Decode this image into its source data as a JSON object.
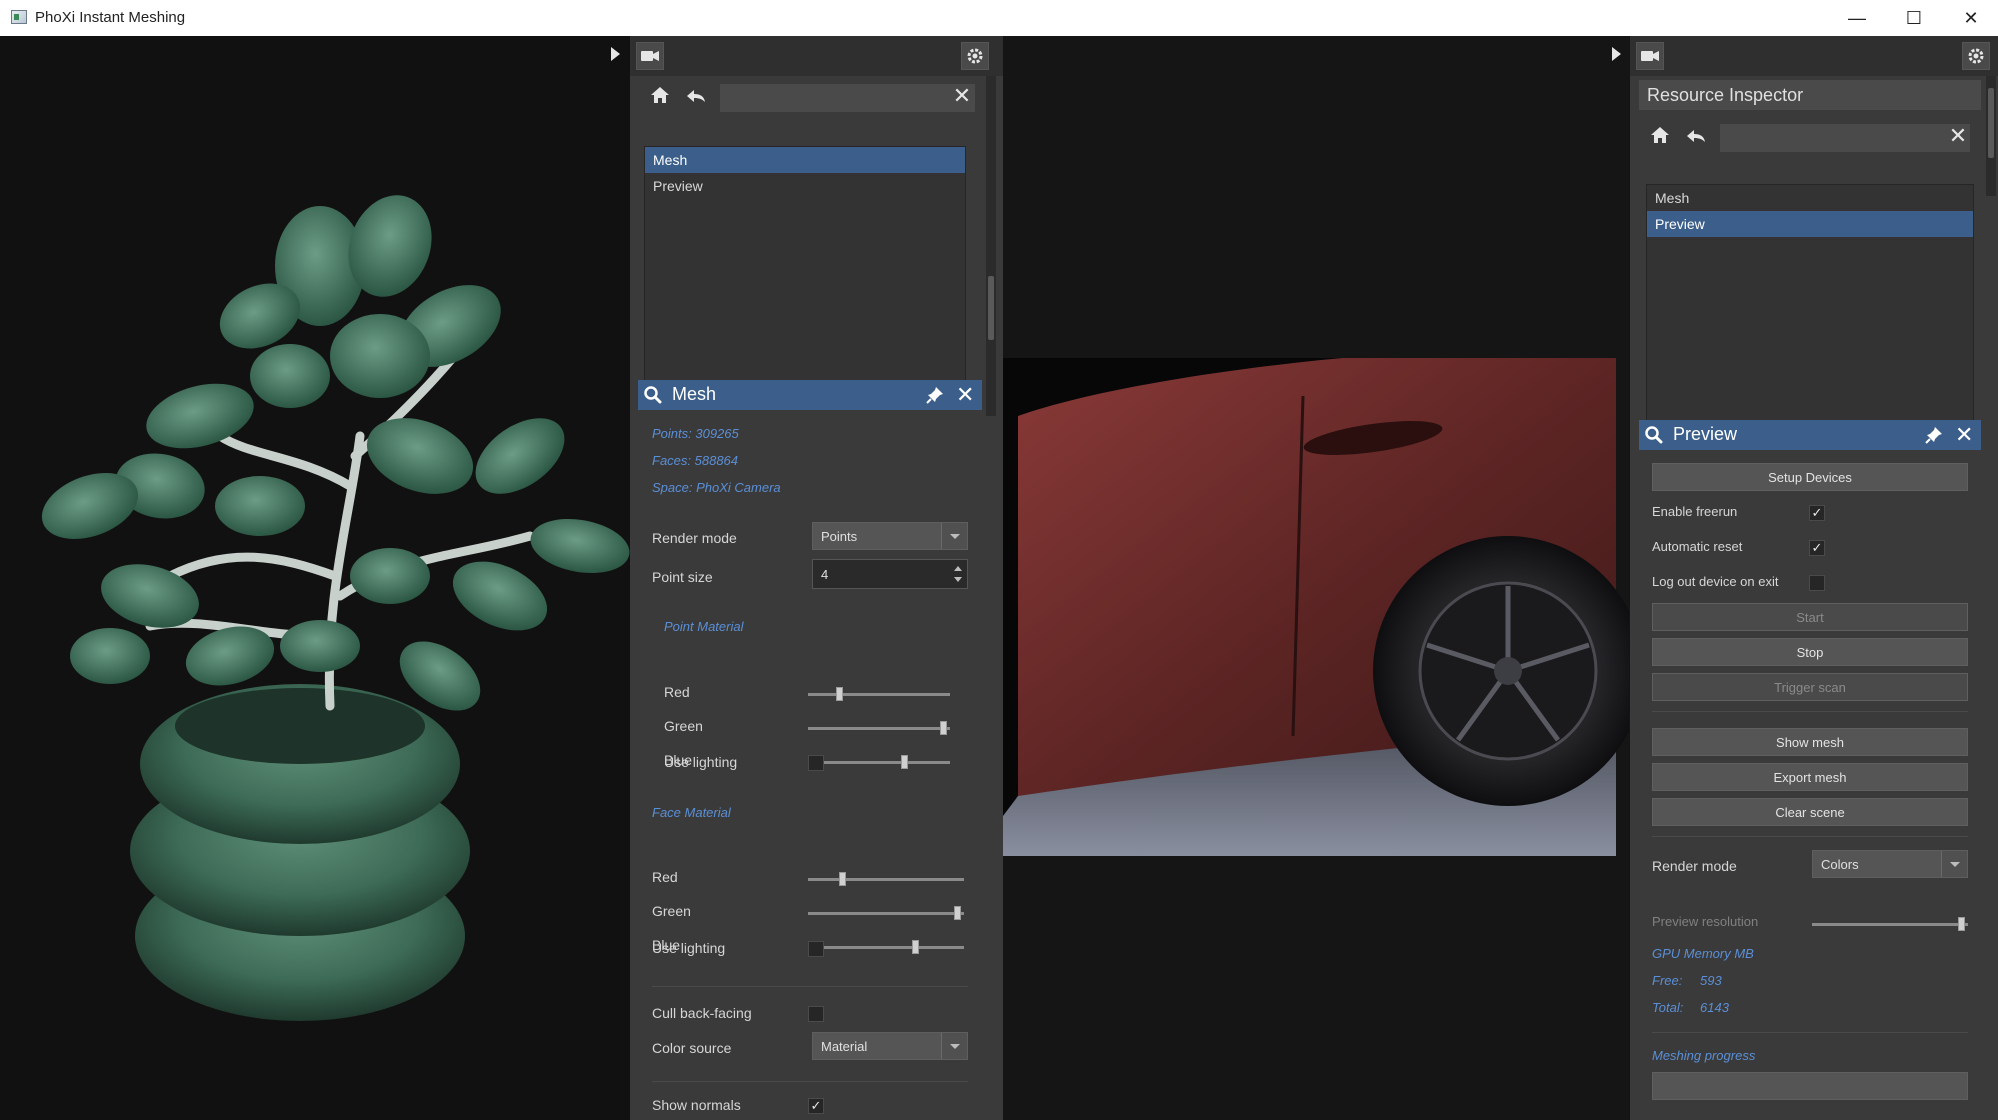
{
  "window": {
    "title": "PhoXi Instant Meshing",
    "minimize_glyph": "—",
    "maximize_glyph": "☐",
    "close_glyph": "✕"
  },
  "center_panel": {
    "scene_list": [
      {
        "label": "Mesh",
        "selected": true
      },
      {
        "label": "Preview",
        "selected": false
      }
    ],
    "inspector": {
      "title": "Mesh",
      "info": [
        "Points: 309265",
        "Faces: 588864",
        "Space: PhoXi Camera"
      ],
      "render_mode_label": "Render mode",
      "render_mode_value": "Points",
      "point_size_label": "Point size",
      "point_size_value": "4",
      "point_material": {
        "title": "Point Material",
        "rows": [
          {
            "label": "Red",
            "value": 0.21
          },
          {
            "label": "Green",
            "value": 0.98
          },
          {
            "label": "Blue",
            "value": 0.69
          }
        ],
        "use_lighting_label": "Use lighting",
        "use_lighting": false
      },
      "face_material": {
        "title": "Face Material",
        "rows": [
          {
            "label": "Red",
            "value": 0.21
          },
          {
            "label": "Green",
            "value": 0.98
          },
          {
            "label": "Blue",
            "value": 0.7
          }
        ],
        "use_lighting_label": "Use lighting",
        "use_lighting": false
      },
      "cull_label": "Cull back-facing",
      "cull": false,
      "color_source_label": "Color source",
      "color_source_value": "Material",
      "show_normals_label": "Show normals",
      "show_normals": true
    }
  },
  "right_panel": {
    "resource_inspector_title": "Resource Inspector",
    "scene_list": [
      {
        "label": "Mesh",
        "selected": false
      },
      {
        "label": "Preview",
        "selected": true
      }
    ],
    "inspector": {
      "title": "Preview",
      "setup_devices": "Setup Devices",
      "enable_freerun_label": "Enable freerun",
      "enable_freerun": true,
      "automatic_reset_label": "Automatic reset",
      "automatic_reset": true,
      "logout_label": "Log out device on exit",
      "logout": false,
      "start": "Start",
      "stop": "Stop",
      "trigger_scan": "Trigger scan",
      "show_mesh": "Show mesh",
      "export_mesh": "Export mesh",
      "clear_scene": "Clear scene",
      "render_mode_label": "Render mode",
      "render_mode_value": "Colors",
      "preview_resolution_label": "Preview resolution",
      "preview_resolution": 0.98,
      "gpu_title": "GPU Memory MB",
      "free_label": "Free:",
      "free_value": "593",
      "total_label": "Total:",
      "total_value": "6143",
      "meshing_progress_label": "Meshing progress",
      "meshing_progress": 0
    }
  },
  "colors": {
    "accent": "#3b5f8a",
    "info_text": "#5b8fd6",
    "panel_bg": "#3a3a3a"
  }
}
